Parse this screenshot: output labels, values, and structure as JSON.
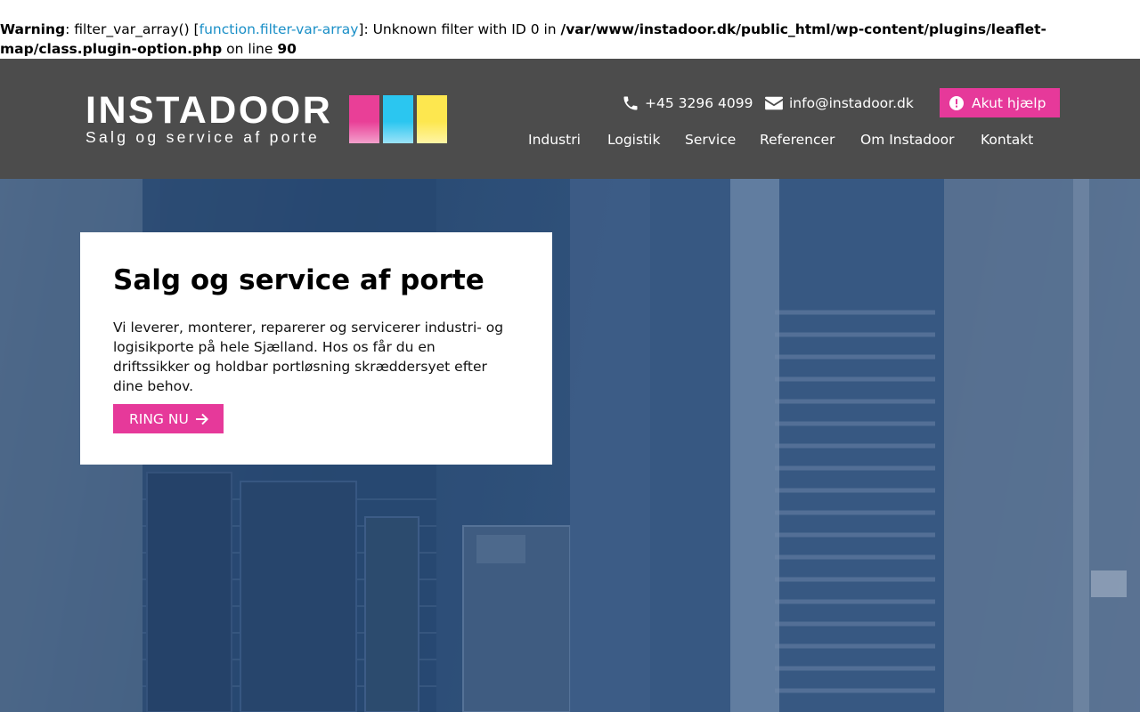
{
  "php_warning": {
    "label": "Warning",
    "before_link": ": filter_var_array() [",
    "link_text": "function.filter-var-array",
    "after_link": "]: Unknown filter with ID 0 in ",
    "path": "/var/www/instadoor.dk/public_html/wp-content/plugins/leaflet-map/class.plugin-option.php",
    "on_line_text": " on line ",
    "line_number": "90"
  },
  "header": {
    "logo": {
      "wordmark": "INSTADOOR",
      "tagline": "Salg og service af porte",
      "swatch_colors": [
        "#e93f97",
        "#2bc6f0",
        "#fde74f"
      ]
    },
    "phone": {
      "icon": "phone-icon",
      "text": "+45 3296 4099"
    },
    "email": {
      "icon": "envelope-icon",
      "text": "info@instadoor.dk"
    },
    "emergency_button": {
      "icon": "alert-circle-icon",
      "label": "Akut hjælp"
    },
    "nav": [
      "Industri",
      "Logistik",
      "Service",
      "Referencer",
      "Om Instadoor",
      "Kontakt"
    ]
  },
  "hero": {
    "title": "Salg og service af porte",
    "text": "Vi leverer, monterer, reparerer og servicerer industri- og logisikporte på hele Sjælland. Hos os får du en driftssikker og holdbar portløsning skræddersyet efter dine behov.",
    "cta": {
      "label": "RING NU",
      "icon": "arrow-right-icon"
    }
  },
  "colors": {
    "header_bg": "#4c4c4c",
    "accent": "#e6399a",
    "link": "#1a8fc7"
  }
}
